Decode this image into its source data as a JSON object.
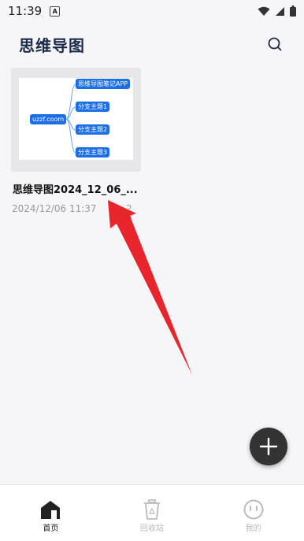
{
  "status_bar": {
    "time": "11:39"
  },
  "header": {
    "title": "思维导图"
  },
  "files": [
    {
      "name": "思维导图2024_12_06_...",
      "date": "2024/12/06 11:37",
      "size": "2 B",
      "thumbnail": {
        "root": "uzzf.coom",
        "branches": [
          "思维导图笔记APP",
          "分支主题1",
          "分支主题2",
          "分支主题3"
        ]
      }
    }
  ],
  "tabs": [
    {
      "label": "首页",
      "icon": "home-icon",
      "active": true
    },
    {
      "label": "回收站",
      "icon": "recycle-bin-icon",
      "active": false
    },
    {
      "label": "我的",
      "icon": "profile-icon",
      "active": false
    }
  ],
  "colors": {
    "accent": "#1a6fe8",
    "fab": "#333333",
    "annotation_arrow": "#e8252b"
  }
}
